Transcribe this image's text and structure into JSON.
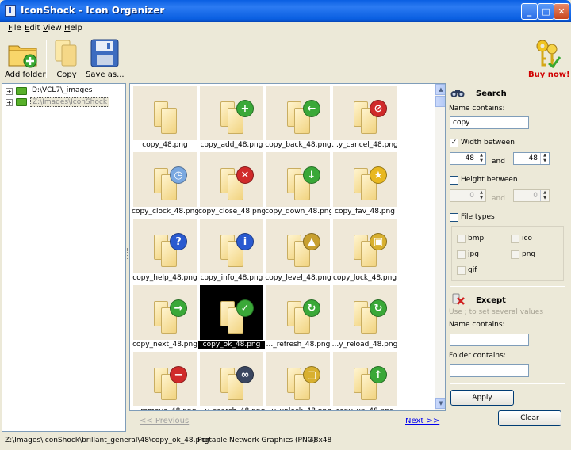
{
  "window": {
    "title": "IconShock - Icon Organizer"
  },
  "menu": [
    "File",
    "Edit",
    "View",
    "Help"
  ],
  "toolbar": {
    "add_folder": "Add folder",
    "copy": "Copy",
    "save_as": "Save as...",
    "buy_now": "Buy now!"
  },
  "tree": {
    "items": [
      {
        "label": "D:\\VCL7\\_images",
        "selected": false
      },
      {
        "label": "Z:\\Images\\IconShock",
        "selected": true
      }
    ]
  },
  "grid": {
    "items": [
      {
        "label": "copy_48.png",
        "emblem": "none"
      },
      {
        "label": "copy_add_48.png",
        "emblem": "plus-icon"
      },
      {
        "label": "copy_back_48.png",
        "emblem": "arrow-left-icon"
      },
      {
        "label": "...y_cancel_48.png",
        "emblem": "cancel-icon"
      },
      {
        "label": "copy_clock_48.png",
        "emblem": "clock-icon"
      },
      {
        "label": "copy_close_48.png",
        "emblem": "close-icon"
      },
      {
        "label": "copy_down_48.png",
        "emblem": "arrow-down-icon"
      },
      {
        "label": "copy_fav_48.png",
        "emblem": "star-icon"
      },
      {
        "label": "copy_help_48.png",
        "emblem": "help-icon"
      },
      {
        "label": "copy_info_48.png",
        "emblem": "info-icon"
      },
      {
        "label": "copy_level_48.png",
        "emblem": "level-icon"
      },
      {
        "label": "copy_lock_48.png",
        "emblem": "lock-icon"
      },
      {
        "label": "copy_next_48.png",
        "emblem": "arrow-right-icon"
      },
      {
        "label": "copy_ok_48.png",
        "emblem": "check-icon"
      },
      {
        "label": "..._refresh_48.png",
        "emblem": "refresh-icon"
      },
      {
        "label": "...y_reload_48.png",
        "emblem": "reload-icon"
      },
      {
        "label": "...remove_48.png",
        "emblem": "minus-icon"
      },
      {
        "label": "...y_search_48.png",
        "emblem": "binoculars-icon"
      },
      {
        "label": "...y_unlock_48.png",
        "emblem": "unlock-icon"
      },
      {
        "label": "copy_up_48.png",
        "emblem": "arrow-up-icon"
      }
    ],
    "selected": "copy_ok_48.png"
  },
  "pager": {
    "previous": "<< Previous",
    "next": "Next >>"
  },
  "search": {
    "title": "Search",
    "name_contains_label": "Name contains:",
    "name_contains_value": "copy",
    "width_between_label": "Width between",
    "width_from": "48",
    "width_to": "48",
    "and": "and",
    "height_between_label": "Height between",
    "height_from": "0",
    "height_to": "0",
    "file_types_label": "File types",
    "types": [
      "bmp",
      "ico",
      "jpg",
      "png",
      "gif"
    ]
  },
  "except": {
    "title": "Except",
    "hint": "Use ; to set several values",
    "name_contains_label": "Name contains:",
    "folder_contains_label": "Folder contains:"
  },
  "buttons": {
    "apply": "Apply",
    "clear": "Clear"
  },
  "status": {
    "path": "Z:\\Images\\IconShock\\brillant_general\\48\\copy_ok_48.png",
    "format": "Portable Network Graphics (PNG)",
    "size": "48x48"
  },
  "colors": {
    "titlebar": "#0a5fe2",
    "buy_now": "#d00000",
    "link": "#0000ee",
    "thumb_bg": "#efe8d8"
  }
}
